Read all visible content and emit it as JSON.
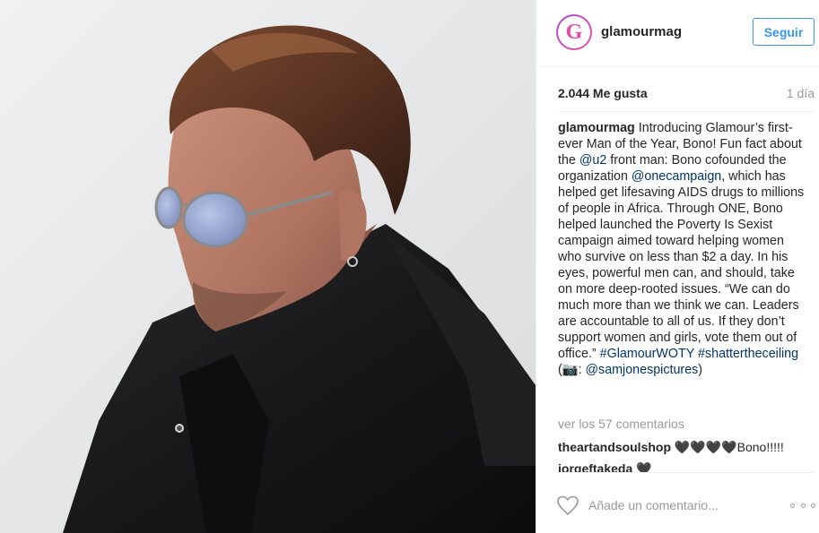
{
  "post": {
    "username": "glamourmag",
    "avatar_letter": "G",
    "follow_label": "Seguir",
    "likes": "2.044 Me gusta",
    "time": "1 día",
    "caption": {
      "username": "glamourmag",
      "t1": " Introducing Glamour’s first-ever Man of the Year, Bono! Fun fact about the ",
      "mention1": "@u2",
      "t2": " front man: Bono cofounded the organization ",
      "mention2": "@onecampaign",
      "t3": ", which has helped get lifesaving AIDS drugs to millions of people in Africa. Through ONE, Bono helped launched the Poverty Is Sexist campaign aimed toward helping women who survive on less than $2 a day. In his eyes, powerful men can, and should, take on more deep-rooted issues. “We can do much more than we think we can. Leaders are accountable to all of us. If they don’t support women and girls, vote them out of office.” ",
      "hashtag1": "#GlamourWOTY",
      "hashtag2": "#shattertheceiling",
      "t4": " (",
      "camera": "📷",
      "t5": ": ",
      "mention3": "@samjonespictures",
      "t6": ")"
    },
    "view_comments": "ver los 57 comentarios",
    "comments": [
      {
        "username": "theartandsoulshop",
        "text": " 🖤🖤🖤🖤Bono!!!!!"
      },
      {
        "username": "jorgeftakeda",
        "text": " 🖤"
      }
    ],
    "add_comment_placeholder": "Añade un comentario..."
  },
  "colors": {
    "link": "#3897f0",
    "tag": "#003569",
    "muted": "#999999",
    "text": "#262626",
    "avatar_gradient": [
      "#b04bd8",
      "#e94fa8"
    ]
  },
  "icons": {
    "like": "heart-outline-icon",
    "more": "more-options-icon"
  }
}
